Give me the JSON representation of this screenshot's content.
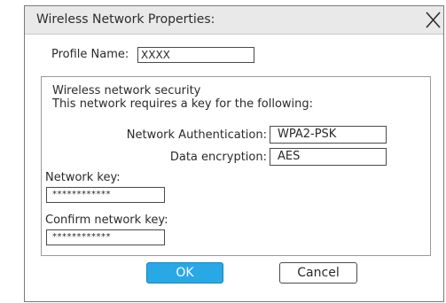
{
  "window": {
    "title": "Wireless Network Properties:",
    "close_icon": "close-x-icon"
  },
  "profile": {
    "label": "Profile Name:",
    "value": "XXXX"
  },
  "security": {
    "heading": "Wireless network security",
    "subheading": "This network requires a key for the following:",
    "auth_label": "Network Authentication:",
    "auth_value": "WPA2-PSK",
    "encryption_label": "Data encryption:",
    "encryption_value": "AES",
    "key_label": "Network key:",
    "key_value": "************",
    "confirm_label": "Confirm network key:",
    "confirm_value": "************"
  },
  "buttons": {
    "ok": "OK",
    "cancel": "Cancel"
  },
  "colors": {
    "ok_button": "#29a8e6",
    "titlebar": "#e9e9e9"
  }
}
